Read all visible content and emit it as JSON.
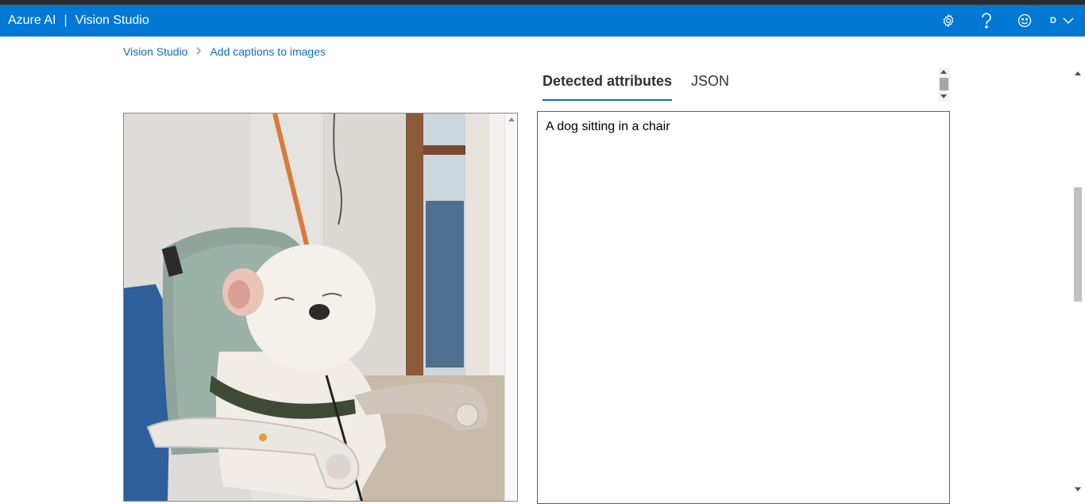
{
  "header": {
    "brand": "Azure AI",
    "separator": "|",
    "product": "Vision Studio",
    "avatar_initial": "D",
    "icons": [
      "gear-icon",
      "help-icon",
      "smiley-feedback-icon",
      "chevron-down-icon"
    ]
  },
  "breadcrumb": {
    "items": [
      "Vision Studio",
      "Add captions to images"
    ],
    "separator_icon": "chevron-right-icon"
  },
  "tabs": [
    {
      "label": "Detected attributes",
      "active": true
    },
    {
      "label": "JSON",
      "active": false
    }
  ],
  "result": {
    "caption": "A dog sitting in a chair"
  },
  "image": {
    "subject_icon": "dog-photo"
  },
  "colors": {
    "header_bg": "#0078d4",
    "link": "#0f6cbd",
    "tab_underline": "#0f6cbd"
  }
}
